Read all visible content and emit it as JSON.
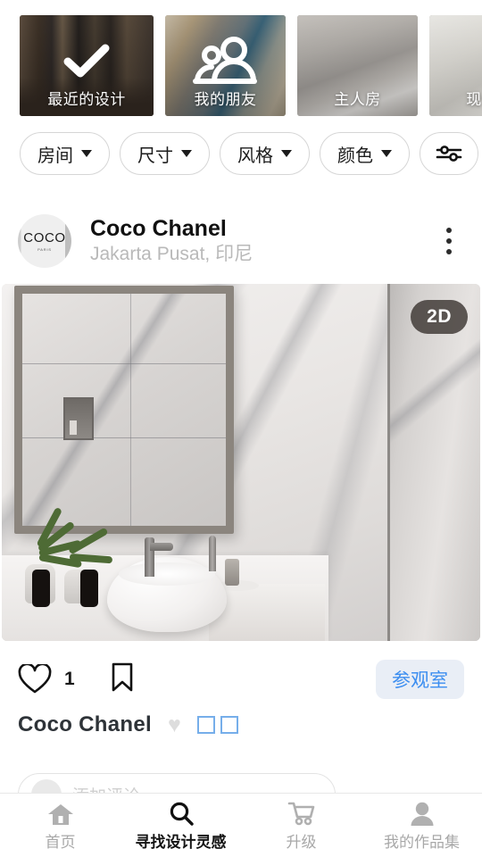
{
  "stories": {
    "items": [
      {
        "label": "最近的设计",
        "overlay_icon": "check-icon"
      },
      {
        "label": "我的朋友",
        "overlay_icon": "people-group-icon"
      },
      {
        "label": "主人房",
        "overlay_icon": ""
      },
      {
        "label": "现代厨",
        "overlay_icon": ""
      }
    ]
  },
  "filters": {
    "chips": [
      {
        "label": "房间",
        "caret": true
      },
      {
        "label": "尺寸",
        "caret": true
      },
      {
        "label": "风格",
        "caret": true
      },
      {
        "label": "颜色",
        "caret": true
      }
    ],
    "tune_icon": "sliders-icon"
  },
  "post": {
    "author": {
      "name": "Coco Chanel",
      "location": "Jakarta Pusat, 印尼",
      "avatar_text": "COCO",
      "avatar_subtext": "PARIS"
    },
    "more_icon": "kebab-menu-icon",
    "image": {
      "badge": "2D",
      "alt": "marble bathroom with mirror and vessel sink"
    },
    "actions": {
      "like_icon": "heart-outline-icon",
      "like_count": "1",
      "bookmark_icon": "bookmark-outline-icon",
      "visit_label": "参观室"
    },
    "caption": {
      "name": "Coco Chanel",
      "heart_emoji": "♥",
      "tofu_count": 2
    },
    "comment": {
      "placeholder": "添加评论…"
    }
  },
  "bottom_nav": {
    "items": [
      {
        "label": "首页",
        "icon": "home-icon",
        "active": false
      },
      {
        "label": "寻找设计灵感",
        "icon": "search-icon",
        "active": true
      },
      {
        "label": "升级",
        "icon": "cart-icon",
        "active": false
      },
      {
        "label": "我的作品集",
        "icon": "person-icon",
        "active": false
      }
    ]
  },
  "colors": {
    "accent_blue": "#3c8ef0",
    "visit_bg": "#e9eef6",
    "tofu_border": "#76aeea",
    "muted": "#a8a8a8"
  }
}
